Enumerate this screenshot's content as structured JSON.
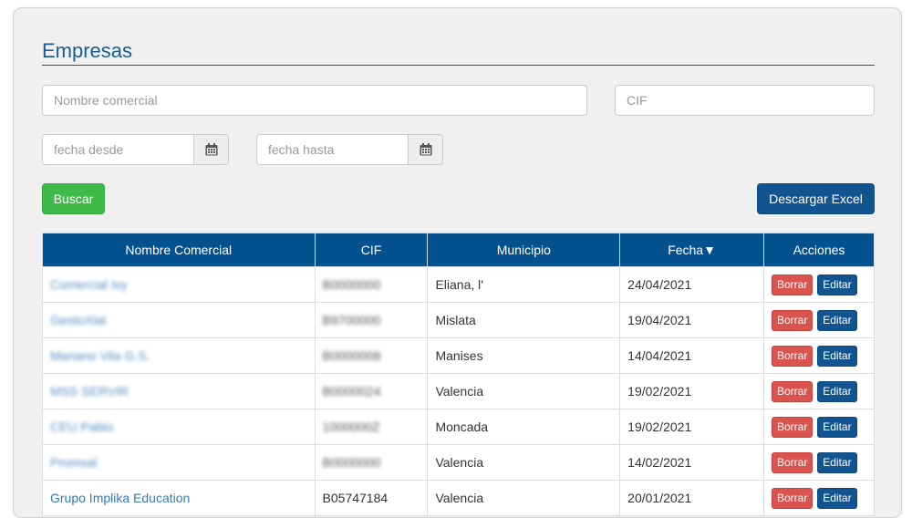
{
  "page": {
    "title": "Empresas"
  },
  "filters": {
    "name_placeholder": "Nombre comercial",
    "cif_placeholder": "CIF",
    "date_from_placeholder": "fecha desde",
    "date_to_placeholder": "fecha hasta"
  },
  "buttons": {
    "search": "Buscar",
    "excel": "Descargar Excel"
  },
  "table": {
    "columns": [
      "Nombre Comercial",
      "CIF",
      "Municipio",
      "Fecha▼",
      "Acciones"
    ],
    "row_actions": {
      "delete": "Borrar",
      "edit": "Editar"
    },
    "rows": [
      {
        "name": "Comercial Ivy",
        "cif": "B0000000",
        "municipio": "Eliana, l'",
        "fecha": "24/04/2021"
      },
      {
        "name": "GestoXlat",
        "cif": "B9700000",
        "municipio": "Mislata",
        "fecha": "19/04/2021"
      },
      {
        "name": "Mariano Vila G.S.",
        "cif": "B0000008",
        "municipio": "Manises",
        "fecha": "14/04/2021"
      },
      {
        "name": "MSS SERVIR",
        "cif": "B0000024",
        "municipio": "Valencia",
        "fecha": "19/02/2021"
      },
      {
        "name": "CEU Pablo",
        "cif": "1000000Z",
        "municipio": "Moncada",
        "fecha": "19/02/2021"
      },
      {
        "name": "Promsal",
        "cif": "B0000000",
        "municipio": "Valencia",
        "fecha": "14/02/2021"
      },
      {
        "name": "Grupo Implika Education",
        "cif": "B05747184",
        "municipio": "Valencia",
        "fecha": "20/01/2021"
      }
    ]
  }
}
